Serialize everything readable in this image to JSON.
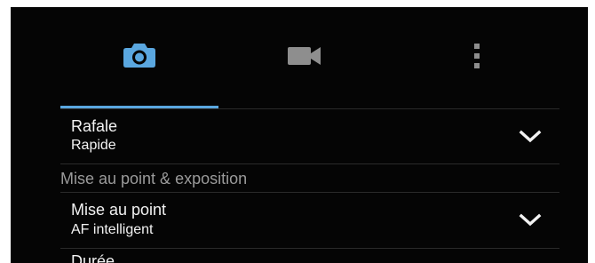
{
  "tabs": [
    {
      "icon": "camera-icon",
      "active": true
    },
    {
      "icon": "video-camera-icon",
      "active": false
    },
    {
      "icon": "more-vertical-icon",
      "active": false
    }
  ],
  "colors": {
    "background": "#050505",
    "accent": "#5aa7e0",
    "text": "#f2f2f2",
    "section_header": "#9a9a9a",
    "divider": "#2a2a2a"
  },
  "settings": {
    "burst": {
      "title": "Rafale",
      "value": "Rapide"
    },
    "section_focus_exposure": "Mise au point & exposition",
    "focus": {
      "title": "Mise au point",
      "value": "AF intelligent"
    },
    "next_row_partial": "Durée"
  }
}
